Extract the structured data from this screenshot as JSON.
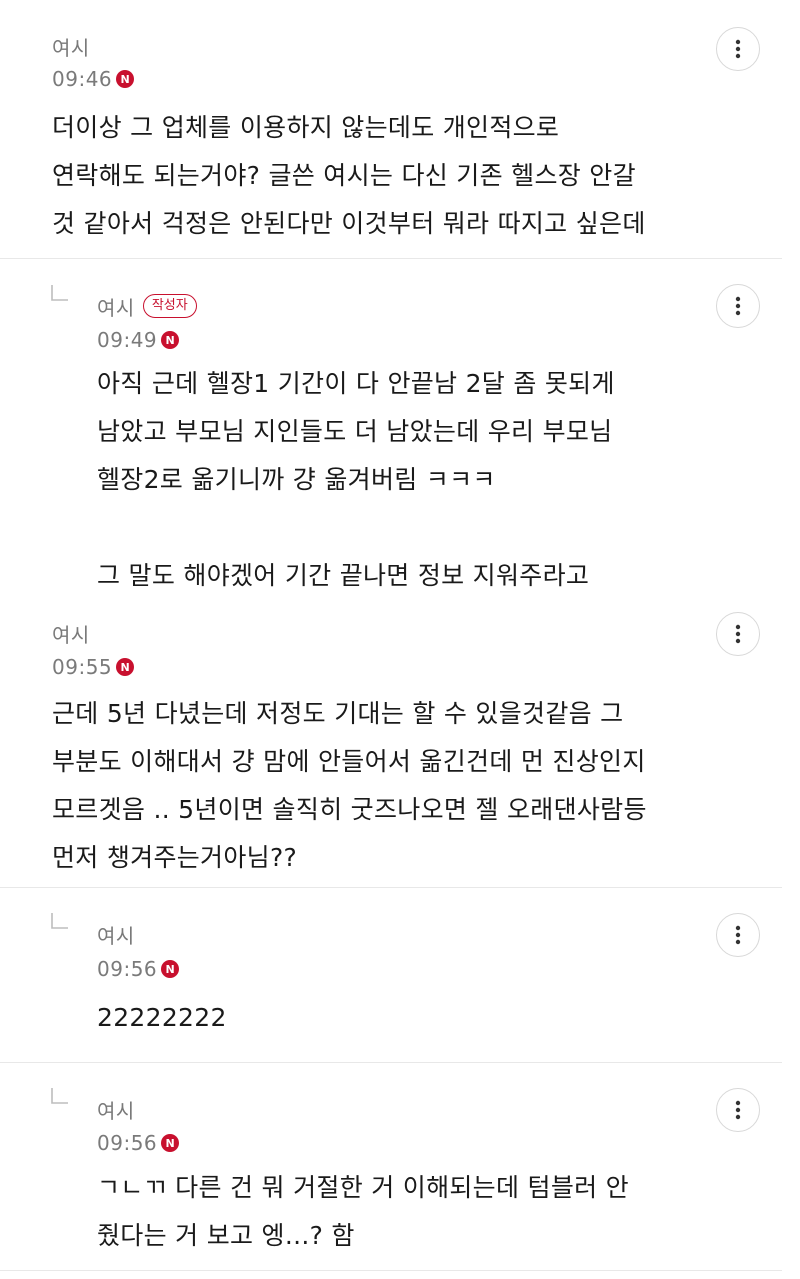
{
  "comments": [
    {
      "author": "여시",
      "time": "09:46",
      "new_badge": "N",
      "text": "더이상 그 업체를 이용하지 않는데도 개인적으로\n연락해도 되는거야? 글쓴 여시는 다신 기존 헬스장 안갈\n것 같아서 걱정은 안된다만 이것부터 뭐라 따지고 싶은데"
    },
    {
      "author": "여시",
      "writer_badge": "작성자",
      "time": "09:49",
      "new_badge": "N",
      "text": "아직 근데 헬장1 기간이 다 안끝남 2달 좀 못되게\n남았고 부모님 지인들도 더 남았는데 우리 부모님\n헬장2로 옮기니까 걍 옮겨버림 ㅋㅋㅋ\n\n그 말도 해야겠어 기간 끝나면 정보 지워주라고"
    },
    {
      "author": "여시",
      "time": "09:55",
      "new_badge": "N",
      "text": "근데 5년 다녔는데 저정도 기대는 할 수 있을것같음 그\n부분도 이해대서 걍 맘에 안들어서 옮긴건데 먼 진상인지\n모르겟음 .. 5년이면 솔직히 굿즈나오면 젤 오래댄사람등\n먼저 챙겨주는거아님??"
    },
    {
      "author": "여시",
      "time": "09:56",
      "new_badge": "N",
      "text": "22222222"
    },
    {
      "author": "여시",
      "time": "09:56",
      "new_badge": "N",
      "text": "ㄱㄴㄲ 다른 건 뭐 거절한 거 이해되는데 텀블러 안\n줬다는 거 보고 엥...? 함"
    }
  ],
  "icons": {
    "more": "more-vertical-icon",
    "reply": "reply-arrow-icon"
  },
  "colors": {
    "accent": "#c8102e",
    "meta_text": "#7a7a7a",
    "body_text": "#1a1a1a",
    "divider": "#e8e8e8"
  }
}
